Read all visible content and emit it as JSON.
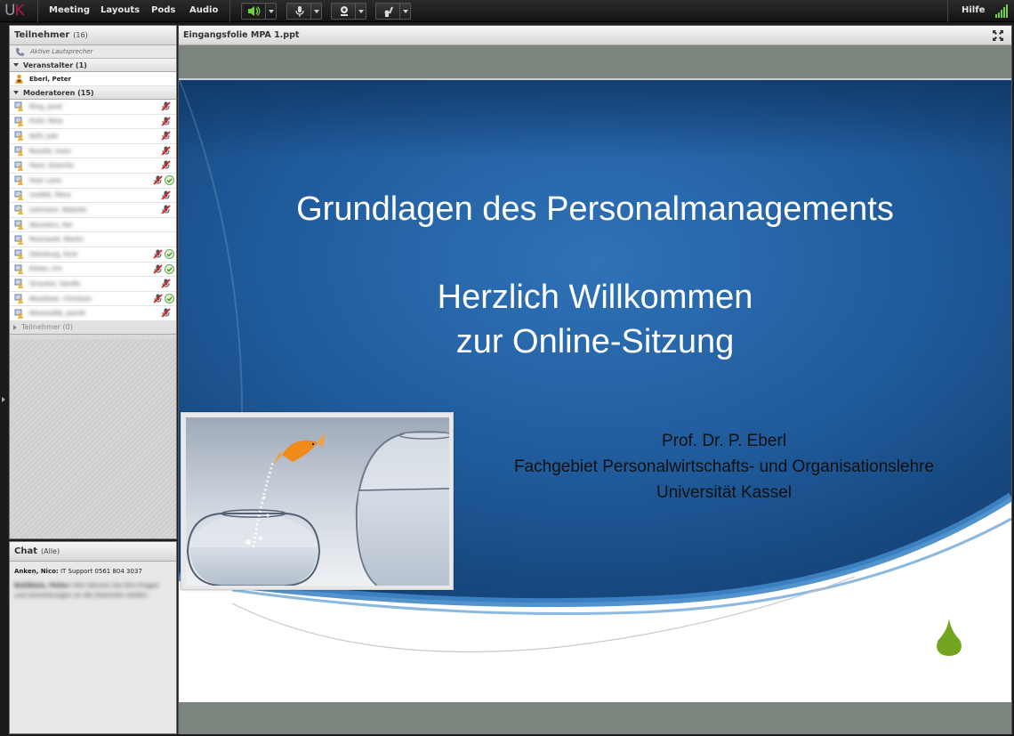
{
  "app": {
    "logo_u": "U",
    "logo_k": "K",
    "menu": [
      "Meeting",
      "Layouts",
      "Pods",
      "Audio"
    ],
    "help_label": "Hilfe",
    "colors": {
      "accent_green": "#6cd43a",
      "logo_red": "#b0164a",
      "slide_blue": "#1f5a9a"
    },
    "toolbar_icons": [
      "speaker-icon",
      "microphone-icon",
      "webcam-icon",
      "raise-hand-icon"
    ]
  },
  "attendees": {
    "title": "Teilnehmer",
    "count": "(16)",
    "active_speakers_label": "Aktive Lautsprecher",
    "hosts": {
      "label": "Veranstalter (1)",
      "users": [
        {
          "name": "Eberl,  Peter"
        }
      ]
    },
    "presenters": {
      "label": "Moderatoren (15)",
      "users": [
        {
          "name": "Ring, Jonel",
          "mic": true,
          "check": false
        },
        {
          "name": "Frohl, Reta",
          "mic": true,
          "check": false
        },
        {
          "name": "Kohl, Jule",
          "mic": true,
          "check": false
        },
        {
          "name": "Roselle, Sven",
          "mic": true,
          "check": false
        },
        {
          "name": "Haut, Stoenila",
          "mic": true,
          "check": false
        },
        {
          "name": "Haar Lane",
          "mic": true,
          "check": true
        },
        {
          "name": "Lesdek, Mara",
          "mic": true,
          "check": false
        },
        {
          "name": "Lehmann, Mabella",
          "mic": true,
          "check": false
        },
        {
          "name": "Wunsters, Ral",
          "mic": false,
          "check": false
        },
        {
          "name": "Rosmaedi, Martin",
          "mic": false,
          "check": false
        },
        {
          "name": "Steinburg, Ferd",
          "mic": true,
          "check": true
        },
        {
          "name": "Kiewa, Irm",
          "mic": true,
          "check": true
        },
        {
          "name": "Strautes, Sandis",
          "mic": true,
          "check": false
        },
        {
          "name": "Moosheer, Christian",
          "mic": true,
          "check": true
        },
        {
          "name": "Klesesedle, Jannik",
          "mic": true,
          "check": false
        }
      ]
    },
    "participants_label": "Teilnehmer (0)"
  },
  "chat": {
    "title": "Chat",
    "scope": "(Alle)",
    "messages": [
      {
        "sender": "Anken, Nico:",
        "text": "IT Support 0561 804 3037",
        "blurred": false
      },
      {
        "sender": "Bohlbam, Peter:",
        "text": "Hier können Sie Ihre Fragen und Anmerkungen an die Dozenten stellen",
        "blurred": true
      }
    ]
  },
  "share": {
    "file_title": "Eingangsfolie MPA 1.ppt",
    "slide": {
      "title": "Grundlagen des Personalmanagements",
      "welcome_line1": "Herzlich Willkommen",
      "welcome_line2": "zur Online-Sitzung",
      "author_name": "Prof. Dr. P. Eberl",
      "author_dept": "Fachgebiet Personalwirtschafts- und Organisationslehre",
      "author_uni": "Universität Kassel"
    }
  }
}
